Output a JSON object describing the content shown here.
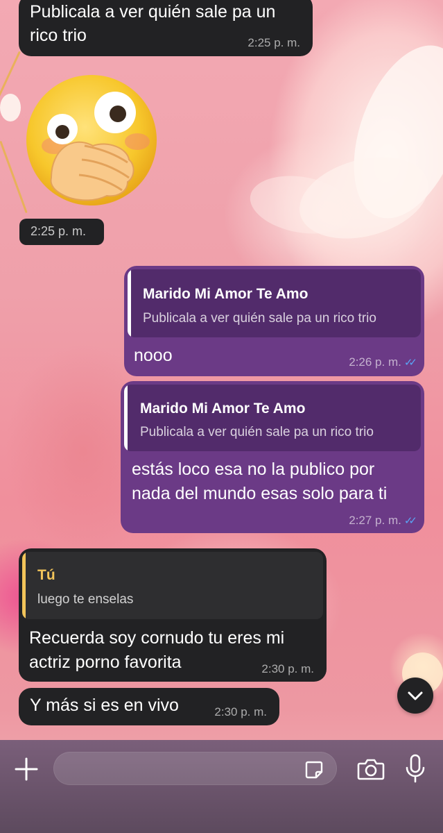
{
  "messages": [
    {
      "direction": "incoming",
      "text": "Publicala a ver quién sale pa un rico trio",
      "time": "2:25 p. m."
    },
    {
      "direction": "incoming",
      "type": "sticker",
      "sticker": "hand-over-mouth-emoji",
      "time": "2:25 p. m."
    },
    {
      "direction": "outgoing",
      "reply_to": {
        "name": "Marido Mi Amor Te Amo",
        "text": "Publicala a ver quién sale pa un rico trio"
      },
      "text": "nooo",
      "time": "2:26 p. m.",
      "status": "read"
    },
    {
      "direction": "outgoing",
      "reply_to": {
        "name": "Marido Mi Amor Te Amo",
        "text": "Publicala a ver quién sale pa un rico trio"
      },
      "text_lines": [
        "estás loco esa no la publico por",
        "nada del mundo esas solo para ti"
      ],
      "time": "2:27 p. m.",
      "status": "read"
    },
    {
      "direction": "incoming",
      "reply_to": {
        "name": "Tú",
        "text": "luego te enselas"
      },
      "text_lines": [
        "Recuerda soy cornudo tu eres mi",
        "actriz porno favorita"
      ],
      "time": "2:30 p. m."
    },
    {
      "direction": "incoming",
      "text": "Y más si es en vivo",
      "time": "2:30 p. m."
    }
  ],
  "colors": {
    "incoming_bubble": "#222224",
    "outgoing_bubble": "#6b3a86",
    "outgoing_quote_accent": "#ffffff",
    "incoming_quote_accent": "#f2c45a",
    "read_ticks": "#5aa5f5"
  },
  "composer": {
    "icons": [
      "plus-icon",
      "sticker-icon",
      "camera-icon",
      "microphone-icon"
    ],
    "input_value": ""
  },
  "scroll_down_icon": "chevron-down-icon"
}
